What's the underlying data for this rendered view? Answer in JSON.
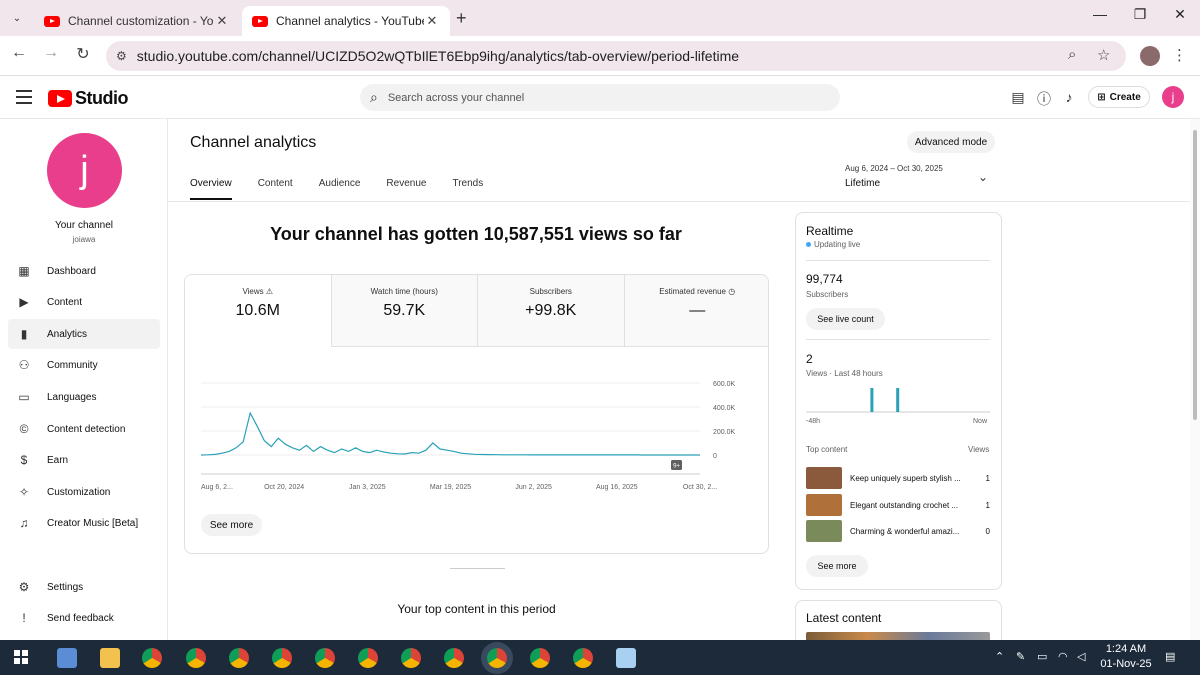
{
  "browser": {
    "tabs": [
      {
        "title": "Channel customization - YouTube Studio",
        "close": "✕"
      },
      {
        "title": "Channel analytics - YouTube Studio",
        "close": "✕"
      }
    ],
    "new_tab": "+",
    "url": "studio.youtube.com/channel/UCIZD5O2wQTbIlET6Ebp9ihg/analytics/tab-overview/period-lifetime"
  },
  "studio": {
    "logo_text": "Studio",
    "search_placeholder": "Search across your channel",
    "create_label": "Create",
    "avatar_letter": "j"
  },
  "sidebar": {
    "avatar_letter": "j",
    "your_channel": "Your channel",
    "handle": "joiawa",
    "items": [
      {
        "label": "Dashboard",
        "icon": "dashboard-icon"
      },
      {
        "label": "Content",
        "icon": "content-icon"
      },
      {
        "label": "Analytics",
        "icon": "analytics-icon"
      },
      {
        "label": "Community",
        "icon": "community-icon"
      },
      {
        "label": "Languages",
        "icon": "languages-icon"
      },
      {
        "label": "Content detection",
        "icon": "copyright-icon"
      },
      {
        "label": "Earn",
        "icon": "dollar-icon"
      },
      {
        "label": "Customization",
        "icon": "magic-wand-icon"
      },
      {
        "label": "Creator Music [Beta]",
        "icon": "music-icon"
      }
    ],
    "bottom": [
      {
        "label": "Settings",
        "icon": "gear-icon"
      },
      {
        "label": "Send feedback",
        "icon": "feedback-icon"
      }
    ]
  },
  "main": {
    "title": "Channel analytics",
    "advanced_mode": "Advanced mode",
    "period_range": "Aug 6, 2024 – Oct 30, 2025",
    "period_label": "Lifetime",
    "tabs": [
      "Overview",
      "Content",
      "Audience",
      "Revenue",
      "Trends"
    ],
    "headline": "Your channel has gotten 10,587,551 views so far",
    "metrics": [
      {
        "label": "Views",
        "value": "10.6M"
      },
      {
        "label": "Watch time (hours)",
        "value": "59.7K"
      },
      {
        "label": "Subscribers",
        "value": "+99.8K"
      },
      {
        "label": "Estimated revenue",
        "value": "—"
      }
    ],
    "see_more": "See more",
    "top_content_title": "Your top content in this period"
  },
  "chart_data": {
    "type": "line",
    "x_ticks": [
      "Aug 6, 2...",
      "Oct 20, 2024",
      "Jan 3, 2025",
      "Mar 19, 2025",
      "Jun 2, 2025",
      "Aug 16, 2025",
      "Oct 30, 2..."
    ],
    "y_ticks": [
      "600.0K",
      "400.0K",
      "200.0K",
      "0"
    ],
    "ylim": [
      0,
      600000
    ],
    "badge": "9+",
    "series": [
      {
        "values": [
          0,
          2000,
          5000,
          15000,
          30000,
          60000,
          110000,
          350000,
          240000,
          120000,
          70000,
          140000,
          90000,
          60000,
          40000,
          80000,
          30000,
          70000,
          40000,
          20000,
          50000,
          30000,
          60000,
          30000,
          20000,
          40000,
          25000,
          15000,
          10000,
          8000,
          20000,
          15000,
          40000,
          100000,
          50000,
          40000,
          30000,
          15000,
          10000,
          6000,
          4000,
          3000,
          2500,
          2000,
          1800,
          1500,
          1500,
          1200,
          1200,
          1000,
          1000,
          1000,
          800,
          800,
          800,
          700,
          700,
          600,
          600,
          600,
          500,
          500,
          500,
          400,
          400,
          400,
          300,
          300,
          300,
          300,
          300,
          300
        ]
      }
    ],
    "color": "#2aa1b8"
  },
  "realtime": {
    "title": "Realtime",
    "status": "Updating live",
    "subscribers_value": "99,774",
    "subscribers_label": "Subscribers",
    "live_count_btn": "See live count",
    "views_value": "2",
    "views_label": "Views · Last 48 hours",
    "axis_start": "-48h",
    "axis_end": "Now",
    "bars": [
      {
        "position": 0.35,
        "value": 1
      },
      {
        "position": 0.49,
        "value": 1
      }
    ],
    "top_content_label": "Top content",
    "views_col_label": "Views",
    "top_content": [
      {
        "title": "Keep uniquely superb stylish ...",
        "views": "1",
        "thumb_color": "#8b5a3c"
      },
      {
        "title": "Elegant outstanding crochet ...",
        "views": "1",
        "thumb_color": "#b0703a"
      },
      {
        "title": "Charming & wonderful amazi...",
        "views": "0",
        "thumb_color": "#7a8a5a"
      }
    ],
    "see_more": "See more",
    "latest_content": "Latest content"
  },
  "taskbar": {
    "time": "1:24 AM",
    "date": "01-Nov-25",
    "apps": [
      "calculator-icon",
      "file-explorer-icon",
      "chrome-icon",
      "chrome-profile-icon",
      "chrome-profile-icon",
      "chrome-profile-icon",
      "chrome-profile-icon",
      "chrome-profile-icon",
      "chrome-profile-icon",
      "chrome-profile-icon",
      "chrome-profile-icon",
      "chrome-profile-icon",
      "notepad-icon"
    ]
  }
}
